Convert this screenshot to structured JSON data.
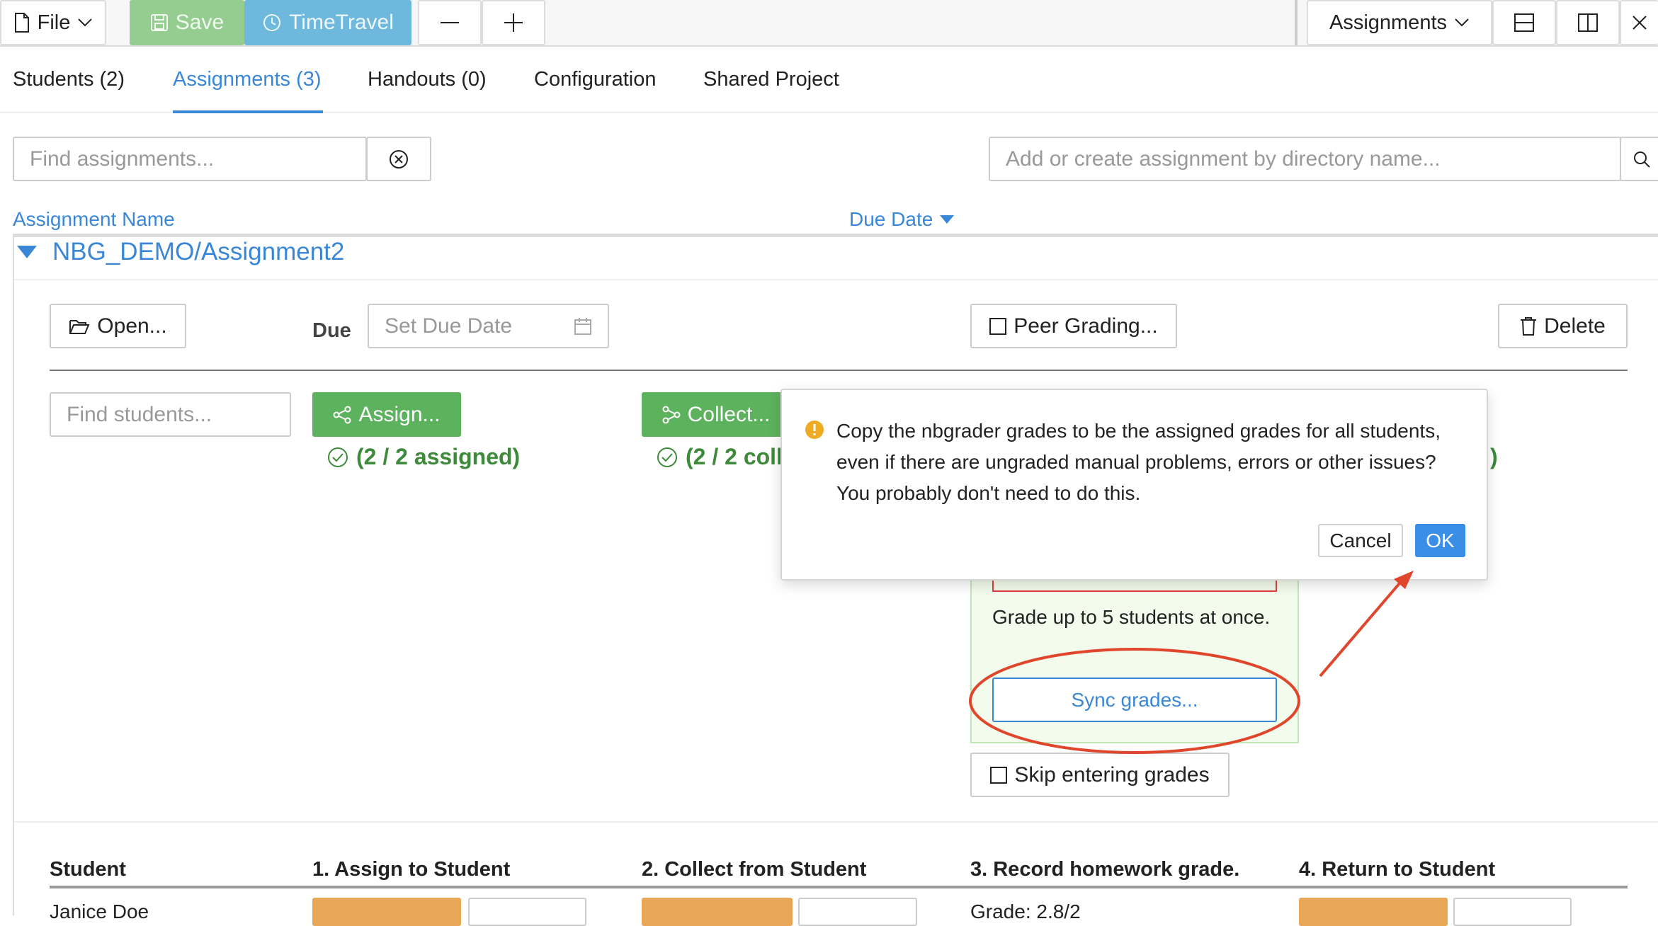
{
  "toolbar": {
    "file_label": "File",
    "save_label": "Save",
    "timetravel_label": "TimeTravel",
    "assignments_menu_label": "Assignments"
  },
  "tabs": [
    {
      "label": "Students (2)"
    },
    {
      "label": "Assignments (3)"
    },
    {
      "label": "Handouts (0)"
    },
    {
      "label": "Configuration"
    },
    {
      "label": "Shared Project"
    }
  ],
  "search": {
    "find_assignments_placeholder": "Find assignments...",
    "add_assignment_placeholder": "Add or create assignment by directory name..."
  },
  "table": {
    "col_name": "Assignment Name",
    "col_due": "Due Date"
  },
  "assignment": {
    "title": "NBG_DEMO/Assignment2",
    "open_label": "Open...",
    "due_label": "Due",
    "due_placeholder": "Set Due Date",
    "peer_label": "Peer Grading...",
    "delete_label": "Delete",
    "find_students_placeholder": "Find students...",
    "assign_label": "Assign...",
    "assign_status": "(2 / 2 assigned)",
    "collect_label": "Collect...",
    "collect_status": "(2 / 2 coll",
    "return_status_fragment": ")",
    "grade_text": "Grade up to 5 students at once.",
    "sync_label": "Sync grades...",
    "skip_label": "Skip entering grades"
  },
  "student_table": {
    "headers": [
      "Student",
      "1. Assign to Student",
      "2. Collect from Student",
      "3. Record homework grade.",
      "4. Return to Student"
    ],
    "first_row": {
      "name": "Janice Doe",
      "grade": "Grade: 2.8/2"
    }
  },
  "dialog": {
    "message": "Copy the nbgrader grades to be the assigned grades for all students, even if there are ungraded manual problems, errors or other issues? You probably don't need to do this.",
    "cancel_label": "Cancel",
    "ok_label": "OK"
  },
  "colors": {
    "accent": "#3a87d8",
    "save_bg": "#95cc90",
    "timetravel_bg": "#6eb7dd",
    "green_button": "#5cb25d",
    "ok_button": "#3a8ee6",
    "annotation_red": "#e0462c",
    "orange_button": "#e8a657"
  }
}
